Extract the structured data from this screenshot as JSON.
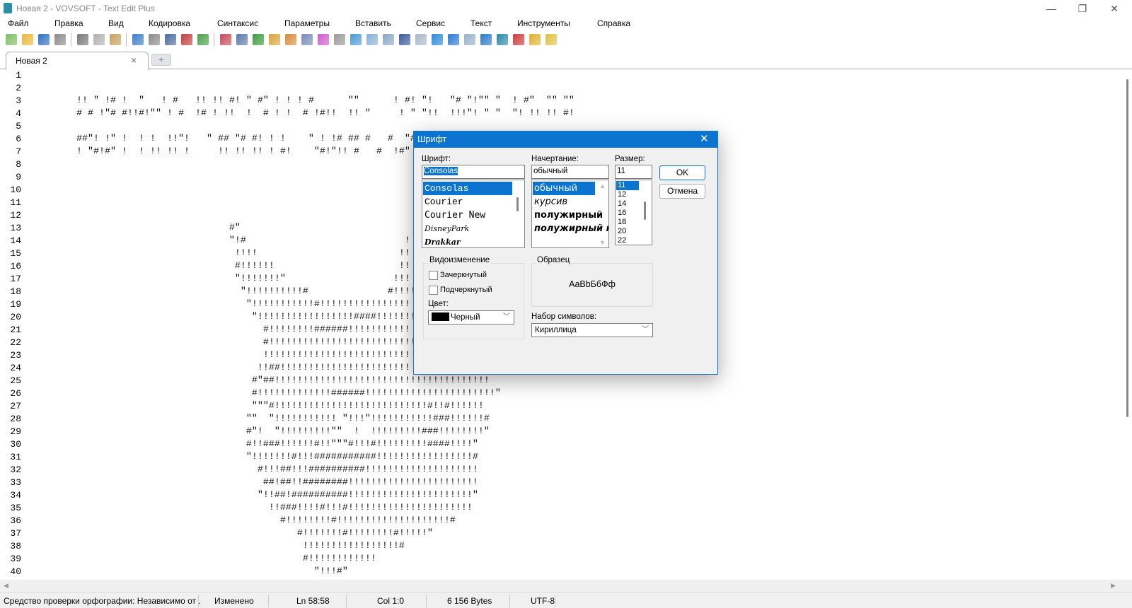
{
  "window": {
    "title": "Новая 2 - VOVSOFT - Text Edit Plus",
    "minimize": "—",
    "maximize": "❐",
    "close": "✕"
  },
  "menu": [
    "Файл",
    "Правка",
    "Вид",
    "Кодировка",
    "Синтаксис",
    "Параметры",
    "Вставить",
    "Сервис",
    "Текст",
    "Инструменты",
    "Справка"
  ],
  "toolbar": {
    "groups": [
      [
        {
          "icon": "new-file-icon",
          "color": "#7fbf5f"
        },
        {
          "icon": "open-folder-icon",
          "color": "#e8b83a"
        },
        {
          "icon": "save-icon",
          "color": "#2f6fc0"
        },
        {
          "icon": "print-icon",
          "color": "#8a8a8a"
        }
      ],
      [
        {
          "icon": "cut-icon",
          "color": "#777777"
        },
        {
          "icon": "copy-icon",
          "color": "#b0b0b0"
        },
        {
          "icon": "paste-icon",
          "color": "#c9a060"
        }
      ],
      [
        {
          "icon": "undo-icon",
          "color": "#3a7ec8"
        },
        {
          "icon": "redo-icon",
          "color": "#8a8a8a"
        },
        {
          "icon": "find-icon",
          "color": "#4a6a9a"
        },
        {
          "icon": "replace-icon",
          "color": "#c04040"
        },
        {
          "icon": "spellcheck-icon",
          "color": "#4aa04a"
        }
      ],
      [
        {
          "icon": "book-icon",
          "color": "#c84a5a"
        },
        {
          "icon": "monitor-icon",
          "color": "#5a7aa8"
        },
        {
          "icon": "font-color-icon",
          "color": "#3a9a3a"
        },
        {
          "icon": "lock-add-icon",
          "color": "#d9a33a"
        },
        {
          "icon": "lock-remove-icon",
          "color": "#d98a3a"
        },
        {
          "icon": "text-style-icon",
          "color": "#7a8ab8"
        },
        {
          "icon": "color-wheel-icon",
          "color": "#d05ad0"
        },
        {
          "icon": "pen-icon",
          "color": "#9a9a9a"
        },
        {
          "icon": "filter-icon",
          "color": "#4a9ad8"
        },
        {
          "icon": "table-icon",
          "color": "#8ab0d8"
        },
        {
          "icon": "mail-icon",
          "color": "#8aa8c8"
        },
        {
          "icon": "numbered-list-icon",
          "color": "#3a5a9a"
        },
        {
          "icon": "keyboard-icon",
          "color": "#a8b8c8"
        },
        {
          "icon": "arrows-horizontal-icon",
          "color": "#2a8ad8"
        },
        {
          "icon": "arrows-vertical-icon",
          "color": "#2a7ad8"
        },
        {
          "icon": "window-icon",
          "color": "#9ab0c8"
        },
        {
          "icon": "sort-az-icon",
          "color": "#2a7ac8"
        },
        {
          "icon": "sort-za-icon",
          "color": "#2a8aa8"
        },
        {
          "icon": "calendar-icon",
          "color": "#d03a3a"
        },
        {
          "icon": "warning-icon",
          "color": "#e0b030"
        },
        {
          "icon": "lightning-file-icon",
          "color": "#e0c040"
        }
      ]
    ]
  },
  "tabs": [
    {
      "label": "Новая 2",
      "close": "×"
    }
  ],
  "tab_add": "+",
  "editor": {
    "lines": [
      "",
      "",
      "        !! \" !# !  \"   ! #   !! !! #! \" #\" ! ! ! #      \"\"      ! #! \"!   \"# \"!\"\" \"  ! #\"  \"\" \"\"",
      "        # # !\"# #!!#!\"\" ! #  !# ! !!  !  # ! !  # !#!!  !! \"     ! \" \"!!  !!!\"! \" \"  \"! !! !! #!",
      "",
      "        ##\"! !\" !  ! !  !!\"!   \" ## \"# #! ! !    \" ! !# ## #   #  \"#",
      "        ! \"#!#\" !  ! !! !! !     !! !! !! ! #!    \"#!\"!! #   #  !#\"",
      "",
      "",
      "",
      "",
      "",
      "                                   #\"",
      "                                   \"!#                            !",
      "                                    !!!!                         !!",
      "                                    #!!!!!!                      !!",
      "                                    \"!!!!!!!\"                   !!!",
      "                                     \"!!!!!!!!!!#              #!!!!",
      "                                      \"!!!!!!!!!!!#!!!!!!!!!!!!!!!!",
      "                                       \"!!!!!!!!!!!!!!!!!####!!!!!!!",
      "                                         #!!!!!!!!######!!!!!!!!!!!",
      "                                         #!!!!!!!!!!!!!!!!!!!!!!!!!!",
      "                                         !!!!!!!!!!!!!!!!!!!!!!!!!!",
      "                                        !!##!!!!!!!!!!!!!!!!!!!!!!!",
      "                                       #\"##!!!!!!!!!!!!!!!!!!!!!!!!!!!!!!!!!!!!!!",
      "                                       #!!!!!!!!!!!!!######!!!!!!!!!!!!!!!!!!!!!!!\"",
      "                                       \"\"\"#!!!!!!!!!!!!!!!!!!!!!!!!!!!#!!#!!!!!!",
      "                                      \"\"  \"!!!!!!!!!!! \"!!!\"!!!!!!!!!!!###!!!!!!#",
      "                                      #\"!  \"!!!!!!!!!\"\"  !  !!!!!!!!!###!!!!!!!!\"",
      "                                      #!!###!!!!!!#!!\"\"\"#!!!#!!!!!!!!!####!!!!\"",
      "                                      \"!!!!!!!#!!!###########!!!!!!!!!!!!!!!!!#",
      "                                        #!!!##!!!##########!!!!!!!!!!!!!!!!!!!!",
      "                                         ##!##!!########!!!!!!!!!!!!!!!!!!!!!!!",
      "                                        \"!!##!##########!!!!!!!!!!!!!!!!!!!!!!\"",
      "                                          !!###!!!!#!!!#!!!!!!!!!!!!!!!!!!!!!!",
      "                                            #!!!!!!!!#!!!!!!!!!!!!!!!!!!!!#",
      "                                               #!!!!!!!#!!!!!!!!#!!!!!\"",
      "                                                !!!!!!!!!!!!!!!!!#",
      "                                                #!!!!!!!!!!!!",
      "                                                  \"!!!#\""
    ],
    "scroll_left": "◀"
  },
  "status": {
    "spellcheck": "Средство проверки орфографии: Независимо от .",
    "modified": "Изменено",
    "line": "Ln 58:58",
    "col": "Col 1:0",
    "size": "6 156 Bytes",
    "encoding": "UTF-8"
  },
  "font_dialog": {
    "title": "Шрифт",
    "close": "✕",
    "font_label": "Шрифт:",
    "font_value": "Consolas",
    "fonts": [
      "Consolas",
      "Courier",
      "Courier New",
      "DisneyPark",
      "Drakkar"
    ],
    "font_selected": "Consolas",
    "style_label": "Начертание:",
    "style_value": "обычный",
    "styles": [
      "обычный",
      "курсив",
      "полужирный",
      "полужирный курсив"
    ],
    "size_label": "Размер:",
    "size_value": "11",
    "sizes": [
      "11",
      "12",
      "14",
      "16",
      "18",
      "20",
      "22"
    ],
    "ok": "OK",
    "cancel": "Отмена",
    "effects_label": "Видоизменение",
    "strikeout": "Зачеркнутый",
    "strikeout_checked": false,
    "underline": "Подчеркнутый",
    "underline_checked": false,
    "color_label": "Цвет:",
    "color_value": "Черный",
    "color_swatch": "#000000",
    "sample_label": "Образец",
    "sample_text": "AaBbБбФф",
    "charset_label": "Набор символов:",
    "charset_value": "Кириллица"
  }
}
